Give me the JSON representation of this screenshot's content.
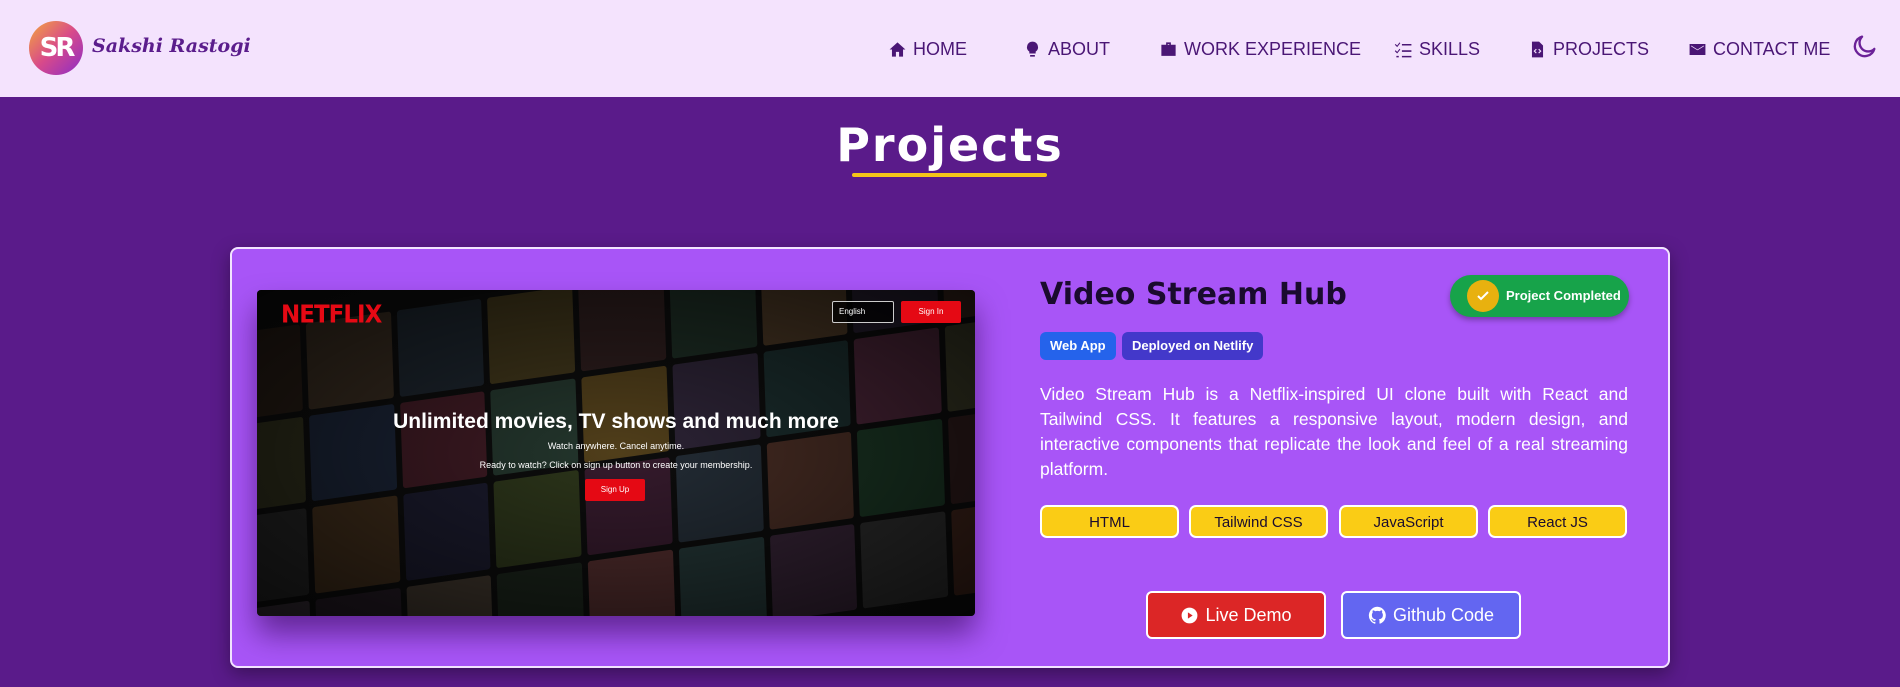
{
  "nav": {
    "logo_text": "SR",
    "brand": "Sakshi Rastogi",
    "items": [
      {
        "label": "HOME",
        "icon": "home-icon"
      },
      {
        "label": "ABOUT",
        "icon": "lightbulb-icon"
      },
      {
        "label": "WORK EXPERIENCE",
        "icon": "briefcase-icon"
      },
      {
        "label": "SKILLS",
        "icon": "list-check-icon"
      },
      {
        "label": "PROJECTS",
        "icon": "file-code-icon"
      },
      {
        "label": "CONTACT ME",
        "icon": "envelope-icon"
      }
    ],
    "theme_toggle_icon": "moon-icon"
  },
  "section": {
    "title": "Projects",
    "accent_color": "#f5c518"
  },
  "project": {
    "title": "Video Stream Hub",
    "status": "Project Completed",
    "tags": [
      "Web App",
      "Deployed on Netlify"
    ],
    "description": "Video Stream Hub is a Netflix-inspired UI clone built with React and Tailwind CSS. It features a responsive layout, modern design, and interactive components that replicate the look and feel of a real streaming platform.",
    "tech": [
      "HTML",
      "Tailwind CSS",
      "JavaScript",
      "React JS"
    ],
    "buttons": {
      "demo": "Live Demo",
      "github": "Github Code"
    },
    "preview": {
      "logo": "NETFLIX",
      "language": "English",
      "signin": "Sign In",
      "headline": "Unlimited movies, TV shows and much more",
      "sub": "Watch anywhere. Cancel anytime.",
      "sub2": "Ready to watch? Click on sign up button to create your membership.",
      "signup": "Sign Up"
    }
  },
  "colors": {
    "page_bg": "#5a1b8a",
    "navbar_bg": "#f4e3fd",
    "card_bg": "#a855f7",
    "status_green": "#17a34a",
    "tech_yellow": "#facc15",
    "demo_red": "#dc2626",
    "github_indigo": "#6366f1"
  }
}
